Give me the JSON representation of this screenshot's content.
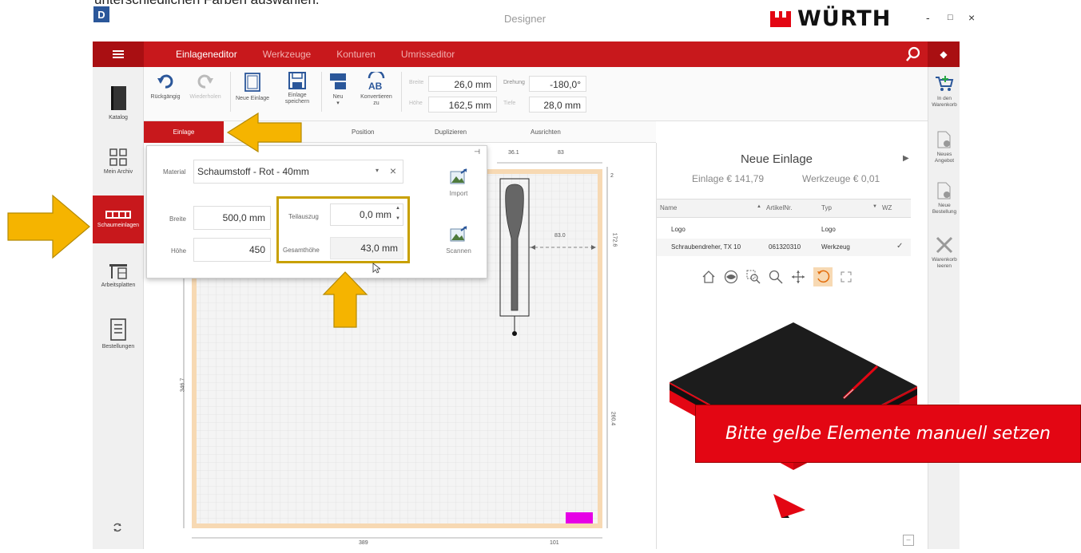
{
  "cut_text": "unterschiedlichen Farben auswählen.",
  "app": {
    "icon_letter": "D",
    "title": "Designer",
    "brand": "WÜRTH",
    "minimize": "-",
    "maximize": "□",
    "close": "×"
  },
  "topbar": {
    "tabs": [
      "Einlageneditor",
      "Werkzeuge",
      "Konturen",
      "Umrisseditor"
    ],
    "collapse": "◆"
  },
  "left_nav": {
    "items": [
      {
        "label": "Katalog"
      },
      {
        "label": "Mein Archiv"
      },
      {
        "label": "Schaumeinlagen"
      },
      {
        "label": "Arbeitsplatten"
      },
      {
        "label": "Bestellungen"
      }
    ]
  },
  "ribbon": {
    "undo": "Rückgängig",
    "redo": "Wiederholen",
    "new_insert": "Neue Einlage",
    "save": "Einlage speichern",
    "new": "Neu",
    "convert": "Konvertieren zu",
    "breite_lbl": "Breite",
    "breite_val": "26,0 mm",
    "hoehe_lbl": "Höhe",
    "hoehe_val": "162,5 mm",
    "drehung_lbl": "Drehung",
    "drehung_val": "-180,0°",
    "tiefe_lbl": "Tiefe",
    "tiefe_val": "28,0 mm"
  },
  "subtabs": {
    "einlage": "Einlage",
    "position": "Position",
    "duplizieren": "Duplizieren",
    "ausrichten": "Ausrichten"
  },
  "panel": {
    "material_lbl": "Material",
    "material_val": "Schaumstoff - Rot - 40mm",
    "breite_lbl": "Breite",
    "breite_val": "500,0 mm",
    "hoehe_lbl": "Höhe",
    "hoehe_val": "450",
    "teilauszug_lbl": "Teilauszug",
    "teilauszug_val": "0,0 mm",
    "gesamthoehe_lbl": "Gesamthöhe",
    "gesamthoehe_val": "43,0 mm",
    "import": "Import",
    "scannen": "Scannen"
  },
  "dims": {
    "top1": "36.1",
    "top2": "83",
    "right_small": "2",
    "right1": "172.6",
    "right2": "260.4",
    "left": "346.7",
    "inner": "83.0",
    "bottom1": "389",
    "bottom2": "101"
  },
  "right_panel": {
    "title": "Neue Einlage",
    "einlage_price": "Einlage € 141,79",
    "werkzeuge_price": "Werkzeuge € 0,01",
    "cols": {
      "name": "Name",
      "artikel": "ArtikelNr.",
      "typ": "Typ",
      "wz": "WZ"
    },
    "rows": [
      {
        "name": "Logo",
        "artikel": "",
        "typ": "Logo",
        "wz": ""
      },
      {
        "name": "Schraubendreher, TX 10",
        "artikel": "061320310",
        "typ": "Werkzeug",
        "wz": "✓"
      }
    ]
  },
  "right_nav": {
    "items": [
      {
        "label": "In den Warenkorb"
      },
      {
        "label": "Neues Angebot"
      },
      {
        "label": "Neue Bestellung"
      },
      {
        "label": "Warenkorb leeren"
      }
    ]
  },
  "banner": "Bitte gelbe Elemente manuell setzen",
  "colors": {
    "brand_red": "#c8181c",
    "highlight_yellow": "#f5b400",
    "magenta": "#e600e6"
  }
}
